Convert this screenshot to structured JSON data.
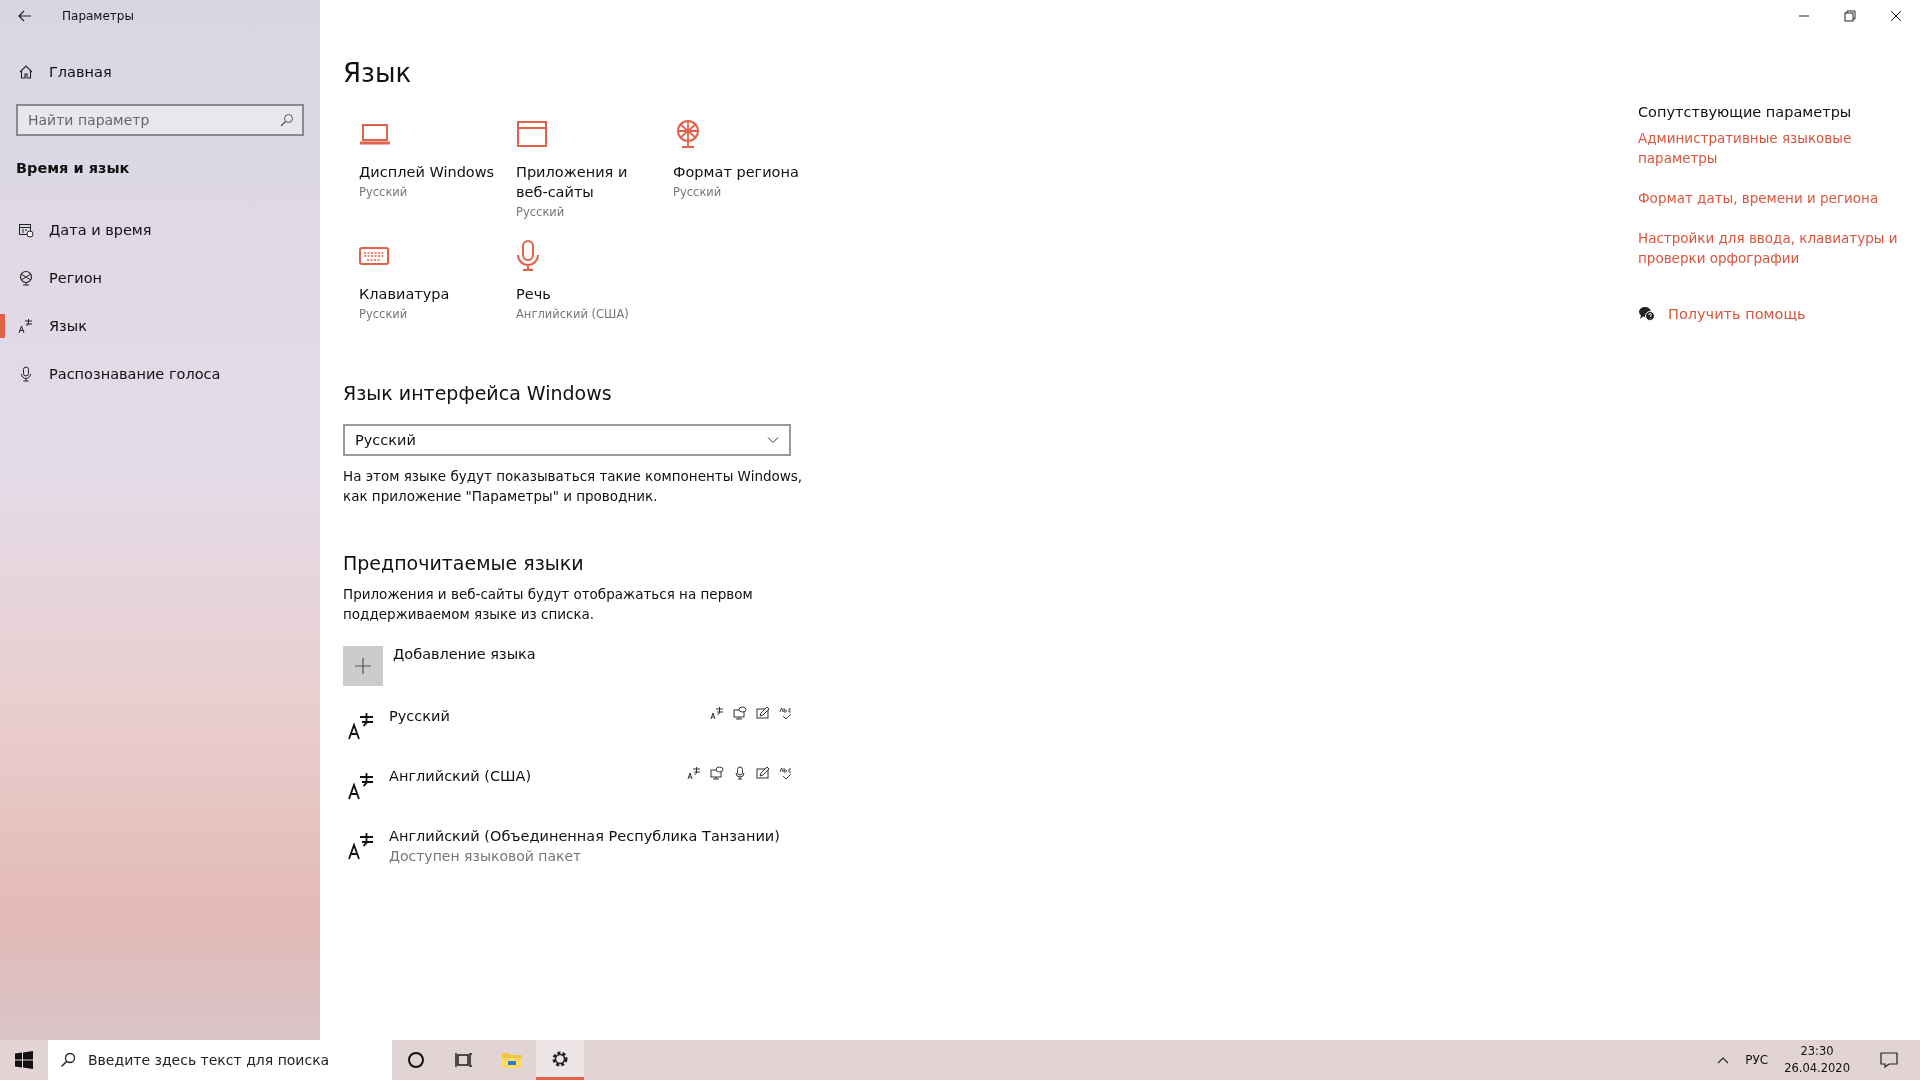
{
  "window": {
    "title": "Параметры"
  },
  "sidebar": {
    "home": "Главная",
    "search": {
      "placeholder": "Найти параметр"
    },
    "section": "Время и язык",
    "items": [
      {
        "label": "Дата и время",
        "kind": "calendar",
        "selected": false
      },
      {
        "label": "Регион",
        "kind": "globe",
        "selected": false
      },
      {
        "label": "Язык",
        "kind": "language",
        "selected": true
      },
      {
        "label": "Распознавание голоса",
        "kind": "microphone",
        "selected": false
      }
    ]
  },
  "page": {
    "title": "Язык",
    "tiles": [
      {
        "kind": "laptop",
        "label": "Дисплей Windows",
        "sub": "Русский"
      },
      {
        "kind": "window",
        "label": "Приложения и веб-сайты",
        "sub": "Русский"
      },
      {
        "kind": "globe",
        "label": "Формат региона",
        "sub": "Русский"
      },
      {
        "kind": "keyboard",
        "label": "Клавиатура",
        "sub": "Русский"
      },
      {
        "kind": "microphone",
        "label": "Речь",
        "sub": "Английский (США)"
      }
    ],
    "interface_language": {
      "heading": "Язык интерфейса Windows",
      "dropdown": "Русский",
      "description": "На этом языке будут показываться такие компоненты Windows, как приложение \"Параметры\" и проводник."
    },
    "preferred": {
      "heading": "Предпочитаемые языки",
      "description": "Приложения и веб-сайты будут отображаться на первом поддерживаемом языке из списка.",
      "add_button": "Добавление языка",
      "languages": [
        {
          "name": "Русский",
          "features": [
            {
              "kind": "language"
            },
            {
              "kind": "display"
            },
            {
              "kind": "handwriting"
            },
            {
              "kind": "spelling"
            }
          ]
        },
        {
          "name": "Английский (США)",
          "features": [
            {
              "kind": "language"
            },
            {
              "kind": "display"
            },
            {
              "kind": "microphone"
            },
            {
              "kind": "handwriting"
            },
            {
              "kind": "spelling"
            }
          ]
        },
        {
          "name": "Английский (Объединенная Республика Танзании)",
          "sub": "Доступен языковой пакет"
        }
      ]
    }
  },
  "related": {
    "heading": "Сопутствующие параметры",
    "links": [
      "Административные языковые параметры",
      "Формат даты, времени и региона",
      "Настройки для ввода, клавиатуры и проверки орфографии"
    ],
    "help": "Получить помощь"
  },
  "taskbar": {
    "search": {
      "placeholder": "Введите здесь текст для поиска"
    },
    "apps": [
      {
        "kind": "cortana",
        "selected": false
      },
      {
        "kind": "taskview",
        "selected": false
      },
      {
        "kind": "explorer",
        "selected": false
      },
      {
        "kind": "settings",
        "selected": true
      }
    ],
    "language": "РУС",
    "time": "23:30",
    "date": "26.04.2020"
  }
}
